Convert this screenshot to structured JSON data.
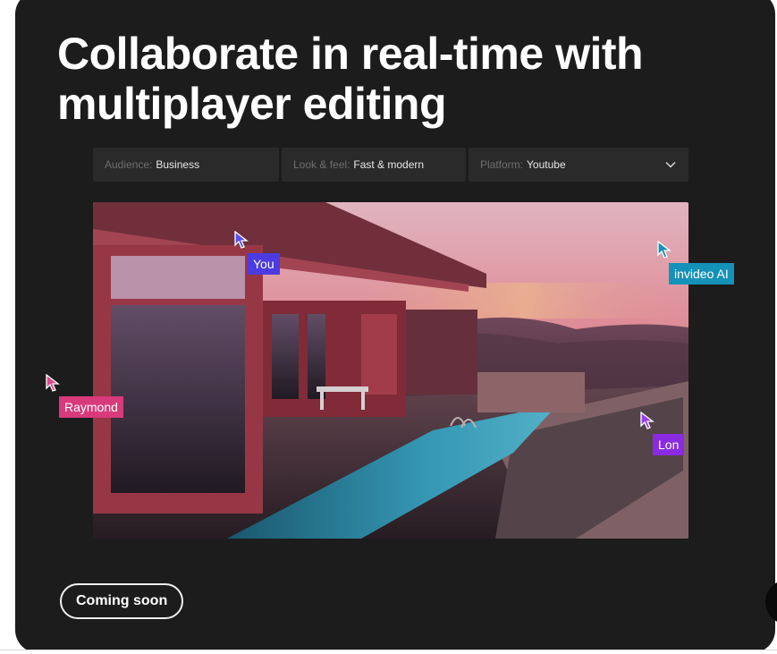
{
  "headline": "Collaborate in real-time with multiplayer editing",
  "filters": [
    {
      "key": "Audience:",
      "value": "Business"
    },
    {
      "key": "Look & feel:",
      "value": "Fast & modern"
    },
    {
      "key": "Platform:",
      "value": "Youtube"
    }
  ],
  "collaborators": [
    {
      "name": "You",
      "color": "#4b3be0"
    },
    {
      "name": "invideo AI",
      "color": "#1592b8"
    },
    {
      "name": "Raymond",
      "color": "#d83a7c"
    },
    {
      "name": "Lon",
      "color": "#8a2be2"
    }
  ],
  "coming_soon_label": "Coming soon",
  "icons": {
    "dropdown": "chevron-down-icon",
    "cursor": "mouse-pointer-icon"
  }
}
